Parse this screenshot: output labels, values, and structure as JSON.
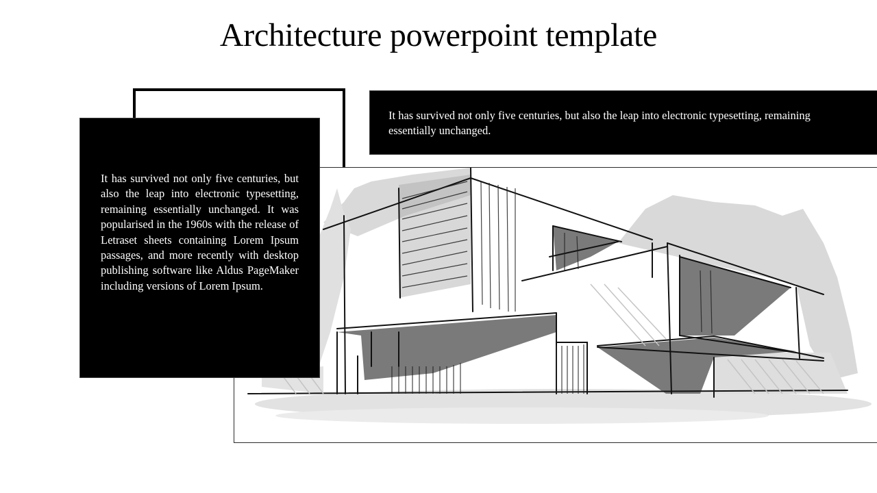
{
  "slide": {
    "title": "Architecture powerpoint template",
    "top_bar_text": "It has survived not only five centuries, but also the leap into electronic typesetting, remaining essentially unchanged.",
    "left_box_text": "It has survived not only five centuries, but also the leap into electronic typesetting, remaining essentially unchanged. It was popularised in the 1960s with the release of Letraset sheets containing Lorem Ipsum passages, and more recently with desktop publishing software like Aldus PageMaker including versions of Lorem Ipsum.",
    "illustration": "architecture-sketch-modern-house"
  },
  "colors": {
    "box_fill": "#000000",
    "box_text": "#ffffff",
    "sketch_shadow": "#7a7a7a",
    "sketch_light": "#d6d6d6",
    "sketch_line": "#111111"
  }
}
